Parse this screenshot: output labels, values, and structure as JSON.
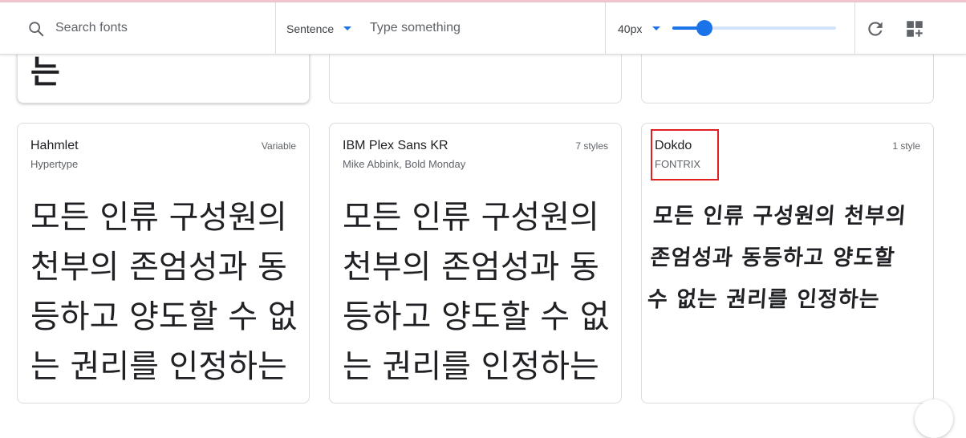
{
  "toolbar": {
    "search_placeholder": "Search fonts",
    "preview_mode": "Sentence",
    "type_placeholder": "Type something",
    "font_size": "40px",
    "font_size_slider_fraction": 0.1,
    "refresh_icon": "refresh-icon",
    "grid_icon": "add-to-collection-icon"
  },
  "top_row": {
    "left_card_partial_text": "는"
  },
  "fonts": [
    {
      "name": "Hahmlet",
      "foundry": "Hypertype",
      "styles": "Variable",
      "sample": "모든 인류 구성원의 천부의 존엄성과 동등하고 양도할 수 없는 권리를 인정하는"
    },
    {
      "name": "IBM Plex Sans KR",
      "foundry": "Mike Abbink, Bold Monday",
      "styles": "7 styles",
      "sample": "모든 인류 구성원의 천부의 존엄성과 동등하고 양도할 수 없는 권리를 인정하는"
    },
    {
      "name": "Dokdo",
      "foundry": "FONTRIX",
      "styles": "1 style",
      "sample": "모든 인류 구성원의 천부의 존엄성과 동등하고 양도할 수 없는 권리를 인정하는"
    }
  ],
  "colors": {
    "accent": "#1a73e8",
    "highlight": "#e02020"
  }
}
